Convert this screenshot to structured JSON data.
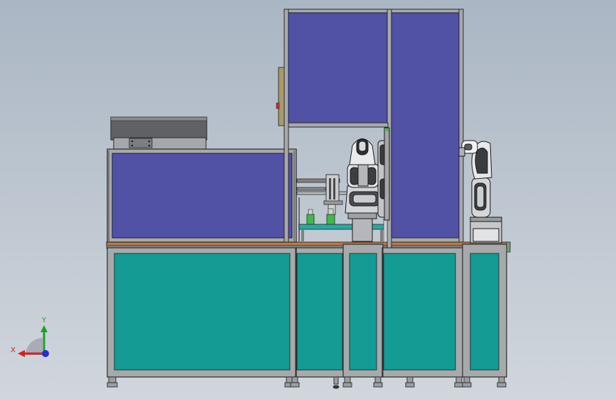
{
  "triad": {
    "x_label": "X",
    "y_label": "Y",
    "x_color": "#d42020",
    "y_color": "#1e9e2e",
    "z_color": "#2431c8"
  },
  "colors": {
    "background_top": "#aab6c4",
    "background_bottom": "#d0d6dc",
    "blue_panel": "#5151a5",
    "teal_panel": "#149b93",
    "frame": "#a7a9ab",
    "table_top": "#b9794a",
    "green_part": "#3fb94a"
  }
}
